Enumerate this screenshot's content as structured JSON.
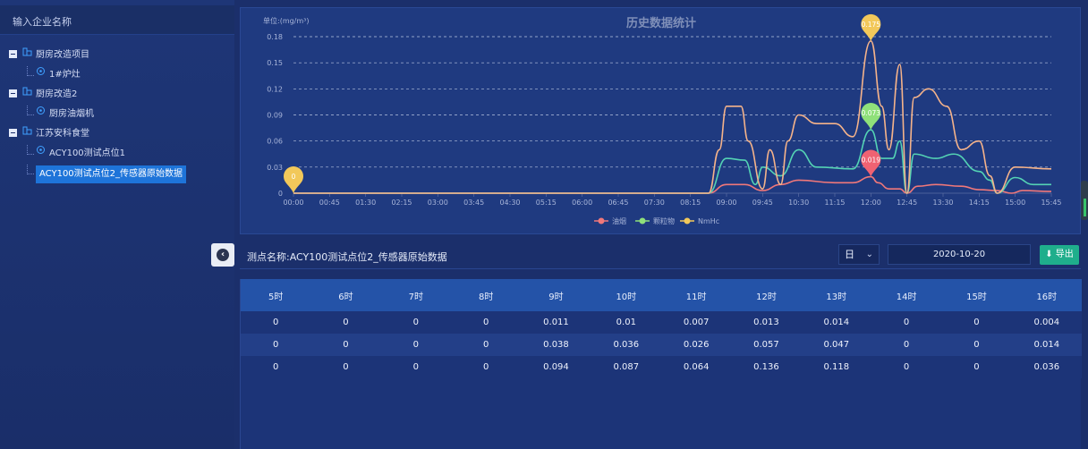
{
  "sidebar": {
    "search_placeholder": "输入企业名称",
    "tree": [
      {
        "label": "厨房改造项目",
        "level": 1
      },
      {
        "label": "1#炉灶",
        "level": 2
      },
      {
        "label": "厨房改造2",
        "level": 1
      },
      {
        "label": "厨房油烟机",
        "level": 2
      },
      {
        "label": "江苏安科食堂",
        "level": 1
      },
      {
        "label": "ACY100测试点位1",
        "level": 2
      },
      {
        "label": "ACY100测试点位2_传感器原始数据",
        "level": 2,
        "selected": true
      }
    ]
  },
  "chart_data": {
    "type": "line",
    "title": "历史数据统计",
    "unit_label": "单位:(mg/m³)",
    "ylim": [
      0,
      0.18
    ],
    "yticks": [
      "0",
      "0.03",
      "0.06",
      "0.09",
      "0.12",
      "0.15",
      "0.18"
    ],
    "categories": [
      "00:00",
      "00:45",
      "01:30",
      "02:15",
      "03:00",
      "03:45",
      "04:30",
      "05:15",
      "06:00",
      "06:45",
      "07:30",
      "08:15",
      "09:00",
      "09:45",
      "10:30",
      "11:15",
      "12:00",
      "12:45",
      "13:30",
      "14:15",
      "15:00",
      "15:45"
    ],
    "series": [
      {
        "name": "油烟",
        "color": "#f0787a",
        "points": [
          [
            0,
            0
          ],
          [
            11.5,
            0
          ],
          [
            12,
            0.01
          ],
          [
            12.5,
            0.01
          ],
          [
            13,
            0.003
          ],
          [
            13.5,
            0.01
          ],
          [
            14,
            0.015
          ],
          [
            15,
            0.012
          ],
          [
            15.5,
            0.012
          ],
          [
            16,
            0.019
          ],
          [
            16.2,
            0.012
          ],
          [
            16.5,
            0.005
          ],
          [
            16.8,
            0.005
          ],
          [
            17,
            0
          ],
          [
            17.3,
            0.008
          ],
          [
            17.8,
            0.01
          ],
          [
            18.5,
            0.008
          ],
          [
            19,
            0.004
          ],
          [
            19.5,
            0.003
          ],
          [
            19.9,
            0
          ],
          [
            20.2,
            0.003
          ],
          [
            21,
            0.002
          ]
        ]
      },
      {
        "name": "颗粒物",
        "color": "#54d3b4",
        "points": [
          [
            0,
            0
          ],
          [
            11.5,
            0
          ],
          [
            12,
            0.04
          ],
          [
            12.5,
            0.038
          ],
          [
            12.8,
            0.01
          ],
          [
            13,
            0.03
          ],
          [
            13.5,
            0.02
          ],
          [
            14,
            0.05
          ],
          [
            14.5,
            0.03
          ],
          [
            15.5,
            0.028
          ],
          [
            16,
            0.073
          ],
          [
            16.3,
            0.04
          ],
          [
            16.6,
            0.04
          ],
          [
            16.8,
            0.06
          ],
          [
            17,
            0
          ],
          [
            17.2,
            0.045
          ],
          [
            17.8,
            0.04
          ],
          [
            18.3,
            0.045
          ],
          [
            19,
            0.025
          ],
          [
            19.3,
            0.015
          ],
          [
            19.5,
            0
          ],
          [
            20,
            0.018
          ],
          [
            20.5,
            0.01
          ],
          [
            21,
            0.01
          ]
        ]
      },
      {
        "name": "NmHc",
        "color": "#f5b38a",
        "points": [
          [
            0,
            0
          ],
          [
            11.5,
            0
          ],
          [
            11.8,
            0.05
          ],
          [
            12,
            0.1
          ],
          [
            12.4,
            0.1
          ],
          [
            12.6,
            0.06
          ],
          [
            13,
            0.005
          ],
          [
            13.2,
            0.05
          ],
          [
            13.5,
            0.01
          ],
          [
            13.7,
            0.06
          ],
          [
            14,
            0.09
          ],
          [
            14.5,
            0.08
          ],
          [
            15,
            0.08
          ],
          [
            15.5,
            0.065
          ],
          [
            16,
            0.175
          ],
          [
            16.3,
            0.1
          ],
          [
            16.5,
            0.05
          ],
          [
            16.8,
            0.148
          ],
          [
            17,
            0
          ],
          [
            17.2,
            0.11
          ],
          [
            17.6,
            0.12
          ],
          [
            18.1,
            0.1
          ],
          [
            18.5,
            0.05
          ],
          [
            19,
            0.06
          ],
          [
            19.3,
            0.02
          ],
          [
            19.5,
            0
          ],
          [
            20,
            0.03
          ],
          [
            21,
            0.028
          ]
        ]
      }
    ],
    "markers": [
      {
        "label": "0",
        "x": 0,
        "y": 0,
        "color": "#f2c85a"
      },
      {
        "label": "0.175",
        "x": 16,
        "y": 0.175,
        "color": "#f2c85a"
      },
      {
        "label": "0.073",
        "x": 16,
        "y": 0.073,
        "color": "#8fe07a"
      },
      {
        "label": "0.019",
        "x": 16,
        "y": 0.019,
        "color": "#f06272"
      }
    ],
    "legend": [
      {
        "name": "油烟",
        "color": "#f0787a"
      },
      {
        "name": "颗粒物",
        "color": "#8fe07a"
      },
      {
        "name": "NmHc",
        "color": "#f2c85a"
      }
    ],
    "grid": "horizontal-dashed",
    "legend_position": "bottom-center"
  },
  "toolbar": {
    "point_label": "测点名称:ACY100测试点位2_传感器原始数据",
    "period_value": "日",
    "date_value": "2020-10-20",
    "export_label": "导出"
  },
  "table": {
    "headers": [
      "5时",
      "6时",
      "7时",
      "8时",
      "9时",
      "10时",
      "11时",
      "12时",
      "13时",
      "14时",
      "15时",
      "16时"
    ],
    "rows": [
      [
        "0",
        "0",
        "0",
        "0",
        "0.011",
        "0.01",
        "0.007",
        "0.013",
        "0.014",
        "0",
        "0",
        "0.004"
      ],
      [
        "0",
        "0",
        "0",
        "0",
        "0.038",
        "0.036",
        "0.026",
        "0.057",
        "0.047",
        "0",
        "0",
        "0.014"
      ],
      [
        "0",
        "0",
        "0",
        "0",
        "0.094",
        "0.087",
        "0.064",
        "0.136",
        "0.118",
        "0",
        "0",
        "0.036"
      ]
    ]
  }
}
